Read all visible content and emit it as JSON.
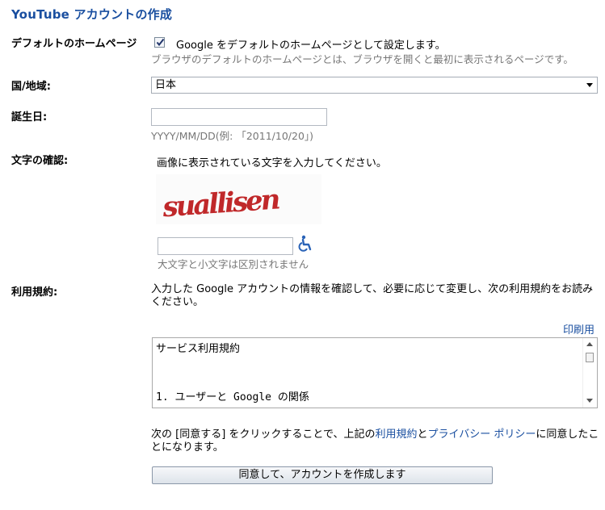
{
  "title": "YouTube アカウントの作成",
  "homepage": {
    "label": "デフォルトのホームページ",
    "checkbox_text": "Google をデフォルトのホームページとして設定します。",
    "hint": "ブラウザのデフォルトのホームページとは、ブラウザを開くと最初に表示されるページです。",
    "checked": true
  },
  "region": {
    "label": "国/地域:",
    "selected": "日本"
  },
  "birthday": {
    "label": "誕生日:",
    "value": "",
    "hint": "YYYY/MM/DD(例: 「2011/10/20」)"
  },
  "captcha": {
    "label": "文字の確認:",
    "instruction": "画像に表示されている文字を入力してください。",
    "image_text": "suallisen",
    "value": "",
    "hint": "大文字と小文字は区別されません"
  },
  "terms": {
    "label": "利用規約:",
    "intro": "入力した Google アカウントの情報を確認して、必要に応じて変更し、次の利用規約をお読みください。",
    "print_link": "印刷用",
    "box_title": "サービス利用規約",
    "box_item": "1. ユーザーと Google の関係"
  },
  "agreement": {
    "prefix": "次の [同意する] をクリックすることで、上記の",
    "terms_link": "利用規約",
    "and": "と",
    "privacy_link": "プライバシー ポリシー",
    "suffix": "に同意したことになります。"
  },
  "submit_label": "同意して、アカウントを作成します",
  "colors": {
    "link": "#1a4fa0",
    "captcha_red": "#c0282a"
  },
  "icons": {
    "accessibility": "wheelchair-icon",
    "dropdown": "chevron-down-icon"
  }
}
